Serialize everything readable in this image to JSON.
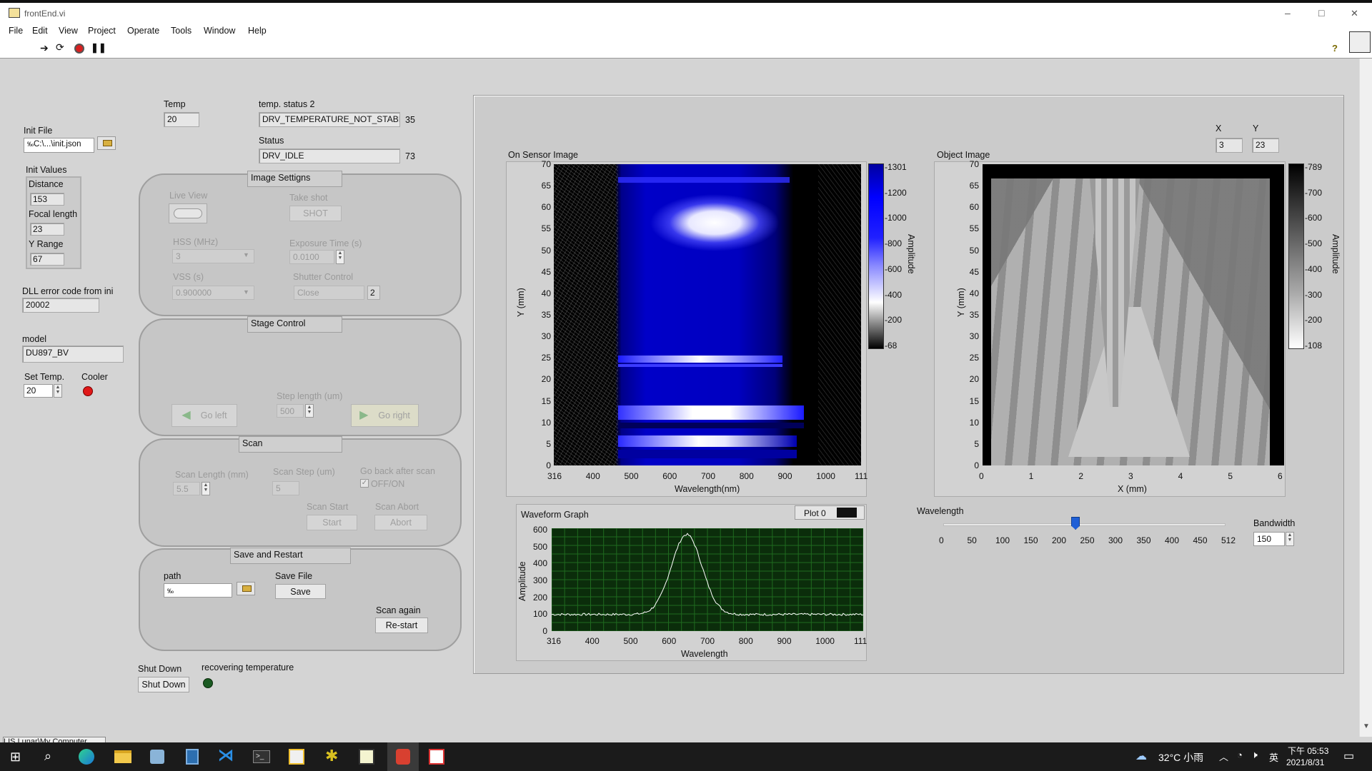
{
  "window": {
    "title": "frontEnd.vi",
    "min": "–",
    "max": "□",
    "close": "✕"
  },
  "menu": [
    "File",
    "Edit",
    "View",
    "Project",
    "Operate",
    "Tools",
    "Window",
    "Help"
  ],
  "toolbar": {
    "help": "?"
  },
  "left": {
    "init_file_label": "Init File",
    "init_file_value": "C:\\...\\init.json",
    "init_values_label": "Init Values",
    "distance_label": "Distance",
    "distance_value": "153",
    "focal_label": "Focal length",
    "focal_value": "23",
    "yrange_label": "Y Range",
    "yrange_value": "67",
    "dll_label": "DLL error code from ini",
    "dll_value": "20002",
    "model_label": "model",
    "model_value": "DU897_BV",
    "set_temp_label": "Set Temp.",
    "set_temp_value": "20",
    "cooler_label": "Cooler",
    "shutdown_label": "Shut Down",
    "shutdown_button": "Shut Down",
    "recovering_label": "recovering temperature"
  },
  "top": {
    "temp_label": "Temp",
    "temp_value": "20",
    "tstatus_label": "temp. status 2",
    "tstatus_value": "DRV_TEMPERATURE_NOT_STABI",
    "tstatus_code": "35",
    "status_label": "Status",
    "status_value": "DRV_IDLE",
    "status_code": "73"
  },
  "image_settings": {
    "title": "Image Settigns",
    "live_view": "Live View",
    "take_shot": "Take shot",
    "shot_button": "SHOT",
    "hss_label": "HSS (MHz)",
    "hss_value": "3",
    "exposure_label": "Exposure Time (s)",
    "exposure_value": "0.0100",
    "vss_label": "VSS (s)",
    "vss_value": "0.900000",
    "shutter_label": "Shutter Control",
    "shutter_value": "Close",
    "shutter_code": "2"
  },
  "stage": {
    "title": "Stage Control",
    "step_label": "Step length (um)",
    "step_value": "500",
    "left_button": "Go left",
    "right_button": "Go right"
  },
  "scan": {
    "title": "Scan",
    "length_label": "Scan Length (mm)",
    "length_value": "5.5",
    "step_label": "Scan Step (um)",
    "step_value": "5",
    "goback_label": "Go back after scan",
    "goback_check": "OFF/ON",
    "start_label": "Scan Start",
    "start_button": "Start",
    "abort_label": "Scan Abort",
    "abort_button": "Abort"
  },
  "save": {
    "title": "Save and Restart",
    "path_label": "path",
    "path_value": "",
    "save_label": "Save File",
    "save_button": "Save",
    "again_label": "Scan again",
    "restart_button": "Re-start"
  },
  "sensor": {
    "title": "On Sensor Image",
    "xlabel": "Wavelength(nm)",
    "ylabel": "Y (mm)",
    "amp_label": "Amplitude",
    "xticks": [
      "316",
      "400",
      "500",
      "600",
      "700",
      "800",
      "900",
      "1000",
      "111"
    ],
    "yticks": [
      "0",
      "5",
      "10",
      "15",
      "20",
      "25",
      "30",
      "35",
      "40",
      "45",
      "50",
      "55",
      "60",
      "65",
      "70"
    ],
    "scale": [
      "1301",
      "1200",
      "1000",
      "800",
      "600",
      "400",
      "200",
      "68"
    ]
  },
  "object": {
    "title": "Object Image",
    "x_label": "X",
    "x_value": "3",
    "y_label": "Y",
    "y_value": "23",
    "xlabel": "X (mm)",
    "ylabel": "Y (mm)",
    "amp_label": "Amplitude",
    "xticks": [
      "0",
      "1",
      "2",
      "3",
      "4",
      "5",
      "6"
    ],
    "yticks": [
      "0",
      "5",
      "10",
      "15",
      "20",
      "25",
      "30",
      "35",
      "40",
      "45",
      "50",
      "55",
      "60",
      "65",
      "70"
    ],
    "scale": [
      "789",
      "700",
      "600",
      "500",
      "400",
      "300",
      "200",
      "108"
    ]
  },
  "waveform": {
    "title": "Waveform Graph",
    "legend": "Plot 0",
    "xlabel": "Wavelength",
    "ylabel": "Amplitude",
    "xticks": [
      "316",
      "400",
      "500",
      "600",
      "700",
      "800",
      "900",
      "1000",
      "111"
    ],
    "yticks": [
      "0",
      "100",
      "200",
      "300",
      "400",
      "500",
      "600"
    ]
  },
  "wavelength_slider": {
    "label": "Wavelength",
    "value": 240,
    "ticks": [
      "0",
      "50",
      "100",
      "150",
      "200",
      "250",
      "300",
      "350",
      "400",
      "450",
      "512"
    ],
    "bandwidth_label": "Bandwidth",
    "bandwidth_value": "150"
  },
  "statusbar": {
    "path": "LIS Lunar\\My Computer"
  },
  "taskbar": {
    "weather": "32°C 小雨",
    "lang": "英",
    "time": "下午 05:53",
    "date": "2021/8/31"
  },
  "colors": {
    "accent": "#1f5fd6",
    "led_red": "#e01818",
    "led_green": "#1a5a22",
    "graph_bg": "#0b2d0b"
  }
}
